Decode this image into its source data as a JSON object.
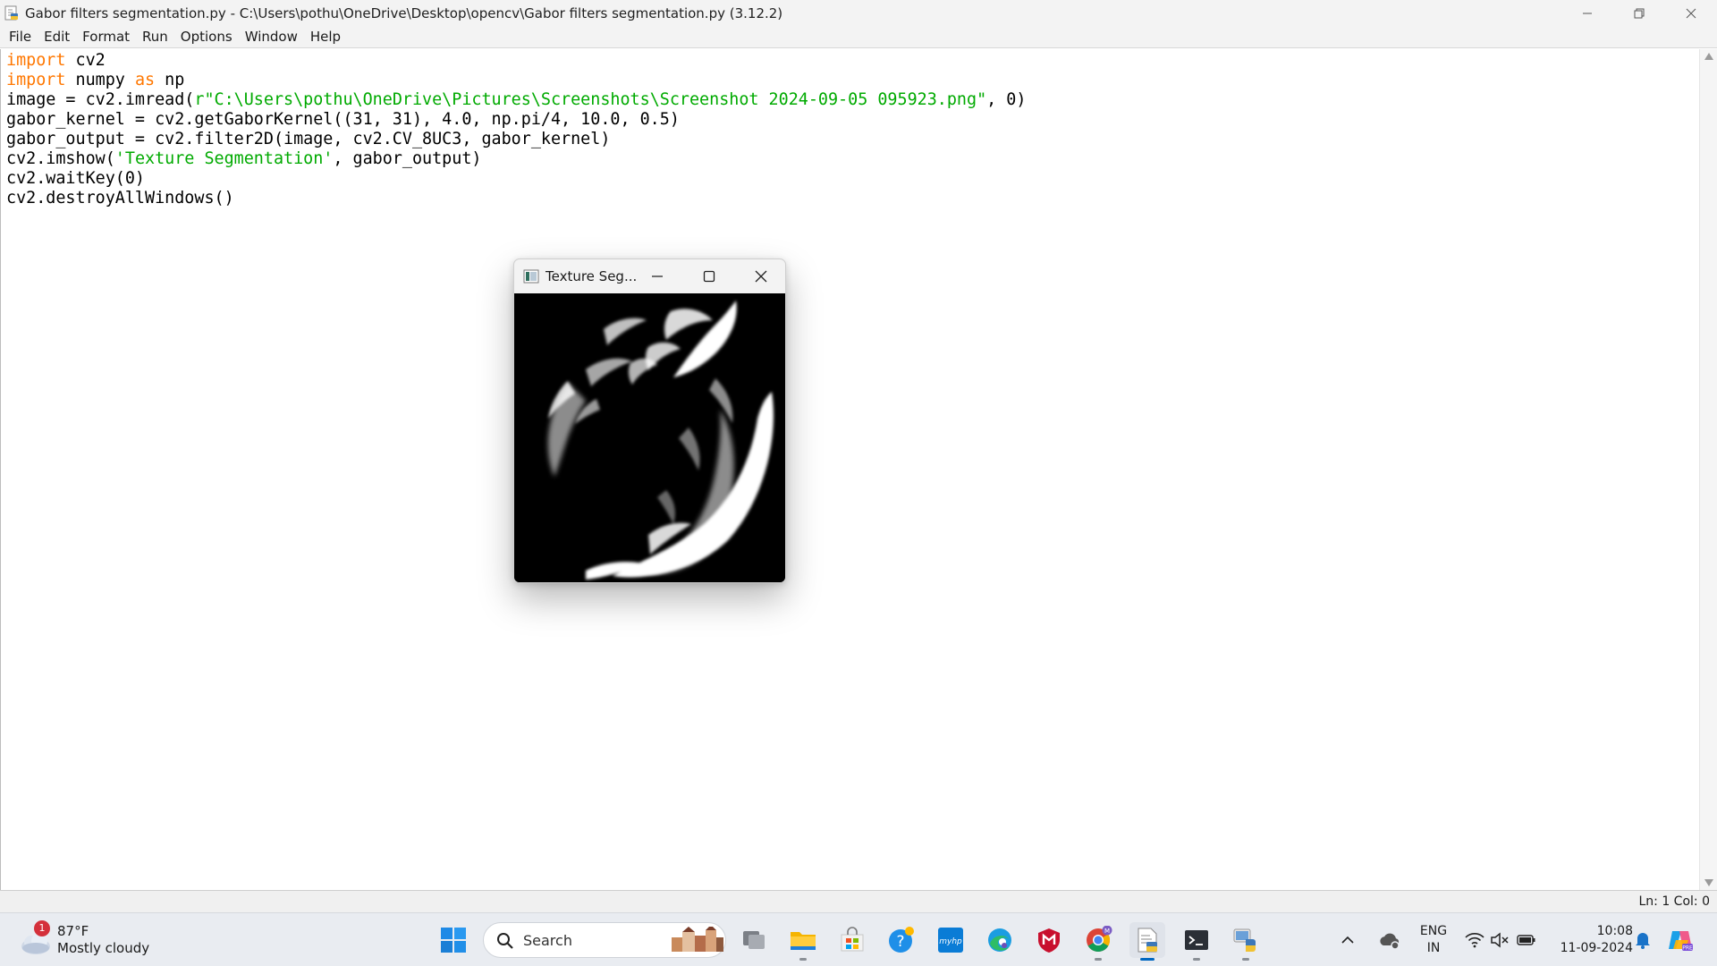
{
  "window": {
    "title": "Gabor filters segmentation.py - C:\\Users\\pothu\\OneDrive\\Desktop\\opencv\\Gabor filters segmentation.py (3.12.2)"
  },
  "menu": {
    "items": [
      "File",
      "Edit",
      "Format",
      "Run",
      "Options",
      "Window",
      "Help"
    ]
  },
  "code": {
    "lines": [
      {
        "tokens": [
          {
            "t": "import",
            "c": "kw"
          },
          {
            "t": " cv2",
            "c": ""
          }
        ]
      },
      {
        "tokens": [
          {
            "t": "import",
            "c": "kw"
          },
          {
            "t": " numpy ",
            "c": ""
          },
          {
            "t": "as",
            "c": "kw"
          },
          {
            "t": " np",
            "c": ""
          }
        ]
      },
      {
        "tokens": [
          {
            "t": "image = cv2.imread(",
            "c": ""
          },
          {
            "t": "r\"C:\\Users\\pothu\\OneDrive\\Pictures\\Screenshots\\Screenshot 2024-09-05 095923.png\"",
            "c": "str"
          },
          {
            "t": ", 0)",
            "c": ""
          }
        ]
      },
      {
        "tokens": [
          {
            "t": "gabor_kernel = cv2.getGaborKernel((31, 31), 4.0, np.pi/4, 10.0, 0.5)",
            "c": ""
          }
        ]
      },
      {
        "tokens": [
          {
            "t": "gabor_output = cv2.filter2D(image, cv2.CV_8UC3, gabor_kernel)",
            "c": ""
          }
        ]
      },
      {
        "tokens": [
          {
            "t": "cv2.imshow(",
            "c": ""
          },
          {
            "t": "'Texture Segmentation'",
            "c": "str"
          },
          {
            "t": ", gabor_output)",
            "c": ""
          }
        ]
      },
      {
        "tokens": [
          {
            "t": "cv2.waitKey(0)",
            "c": ""
          }
        ]
      },
      {
        "tokens": [
          {
            "t": "cv2.destroyAllWindows()",
            "c": ""
          }
        ]
      }
    ]
  },
  "status": {
    "position": "Ln: 1   Col: 0"
  },
  "image_window": {
    "title": "Texture Seg..."
  },
  "taskbar": {
    "weather_temp": "87°F",
    "weather_desc": "Mostly cloudy",
    "weather_badge": "1",
    "search_placeholder": "Search",
    "lang_line1": "ENG",
    "lang_line2": "IN",
    "time": "10:08",
    "date": "11-09-2024"
  }
}
